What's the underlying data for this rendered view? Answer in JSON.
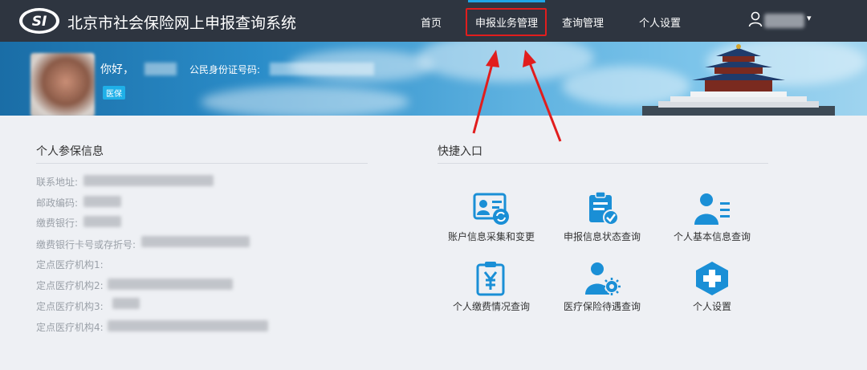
{
  "header": {
    "logo_text": "SI",
    "title": "北京市社会保险网上申报查询系统",
    "nav": [
      {
        "label": "首页"
      },
      {
        "label": "申报业务管理"
      },
      {
        "label": "查询管理"
      },
      {
        "label": "个人设置"
      }
    ],
    "user_caret": "▾"
  },
  "banner": {
    "greeting": "你好，",
    "id_label": "公民身份证号码:",
    "badge": "医保"
  },
  "personal_info": {
    "title": "个人参保信息",
    "fields": [
      {
        "label": "联系地址:"
      },
      {
        "label": "邮政编码:"
      },
      {
        "label": "缴费银行:"
      },
      {
        "label": "缴费银行卡号或存折号:"
      },
      {
        "label": "定点医疗机构1:"
      },
      {
        "label": "定点医疗机构2:"
      },
      {
        "label": "定点医疗机构3:"
      },
      {
        "label": "定点医疗机构4:"
      }
    ]
  },
  "quick_entry": {
    "title": "快捷入口",
    "items": [
      {
        "label": "账户信息采集和变更",
        "icon": "id-card-sync-icon"
      },
      {
        "label": "申报信息状态查询",
        "icon": "clipboard-check-icon"
      },
      {
        "label": "个人基本信息查询",
        "icon": "person-list-icon"
      },
      {
        "label": "个人缴费情况查询",
        "icon": "clipboard-yen-icon"
      },
      {
        "label": "医疗保险待遇查询",
        "icon": "person-gear-icon"
      },
      {
        "label": "个人设置",
        "icon": "plus-circle-icon"
      }
    ]
  },
  "colors": {
    "topbar": "#2e3540",
    "accent": "#1ea5e6",
    "highlight_red": "#e11d1d",
    "icon_blue": "#1a8fd6"
  }
}
